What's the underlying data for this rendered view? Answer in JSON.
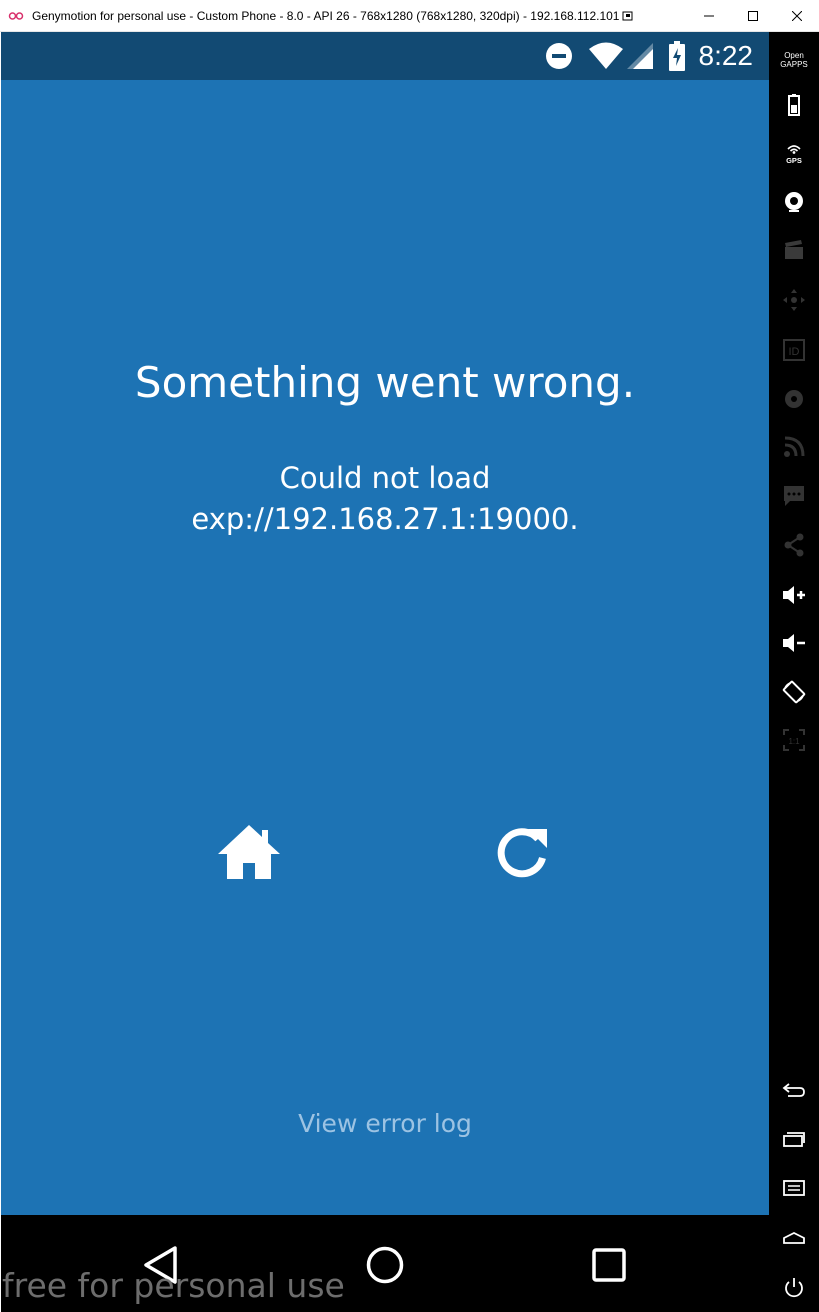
{
  "window": {
    "title": "Genymotion for personal use - Custom Phone - 8.0 - API 26 - 768x1280 (768x1280, 320dpi) - 192.168.112.101",
    "controls": [
      "minimize",
      "maximize",
      "close"
    ]
  },
  "statusbar": {
    "time": "8:22",
    "icons": [
      "do-not-disturb-icon",
      "wifi-icon",
      "cell-signal-icon",
      "battery-charging-icon"
    ]
  },
  "error": {
    "title": "Something went wrong.",
    "message_line1": "Could not load",
    "message_line2": "exp://192.168.27.1:19000.",
    "view_log": "View error log",
    "actions": [
      "home-icon",
      "reload-icon"
    ]
  },
  "navbar": {
    "buttons": [
      "back-icon",
      "home-circle-icon",
      "recents-icon"
    ]
  },
  "sidebar": {
    "opengapps_line1": "Open",
    "opengapps_line2": "GAPPS",
    "gps_label": "GPS",
    "identifiers_label": "ID",
    "pixel_ratio_label": "1:1",
    "tools": [
      "opengapps",
      "battery",
      "gps",
      "webcam",
      "capture",
      "remote-control",
      "identifiers",
      "disk-io",
      "network",
      "phone-sms",
      "share",
      "volume-up",
      "volume-down",
      "rotate",
      "pixel-perfect",
      "back",
      "recent-apps",
      "menu",
      "home",
      "power"
    ]
  },
  "watermark": "free for personal use",
  "colors": {
    "screen_bg": "#1d73b4",
    "statusbar_bg": "#124a73",
    "view_log_text": "#9cc3e3",
    "toolbar_bg": "#000000"
  }
}
